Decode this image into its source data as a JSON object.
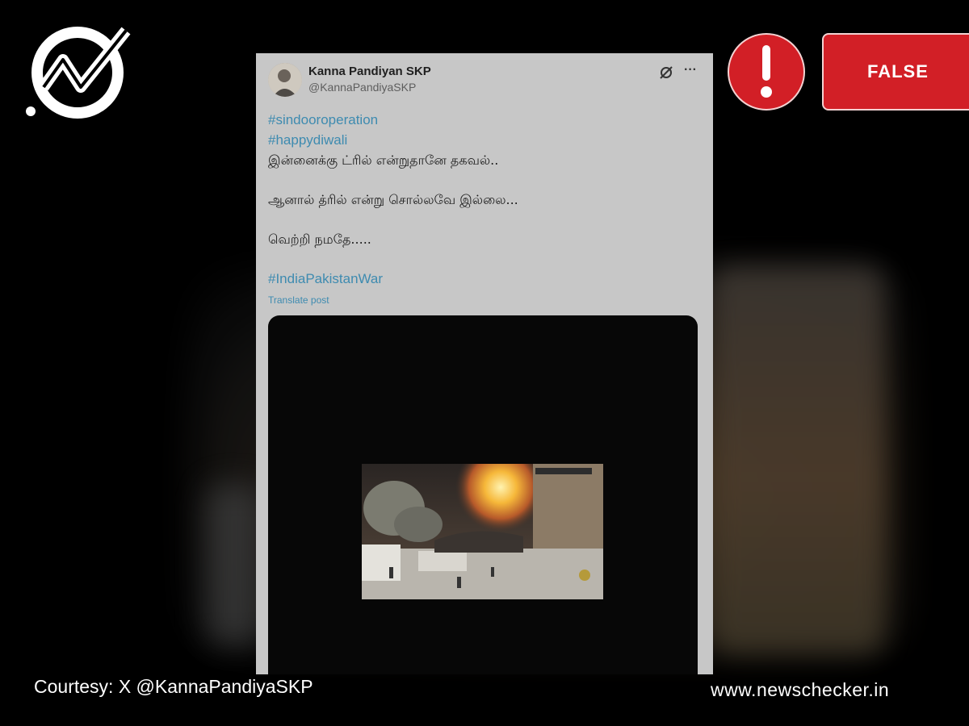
{
  "verdict": {
    "label": "FALSE",
    "color": "#d21f26",
    "icon": "exclamation-icon"
  },
  "logo": {
    "icon": "newschecker-check-logo"
  },
  "tweet": {
    "display_name": "Kanna Pandiyan SKP",
    "handle": "@KannaPandiyaSKP",
    "hashtags_top": [
      "#sindooroperation",
      "#happydiwali"
    ],
    "lines": [
      "இன்னைக்கு ட்ரில் என்றுதானே தகவல்..",
      "ஆனால் த்ரில் என்று சொல்லவே இல்லை...",
      "வெற்றி நமதே....."
    ],
    "hashtag_bottom": "#IndiaPakistanWar",
    "translate_label": "Translate post",
    "media": "video-thumbnail"
  },
  "footer": {
    "courtesy": "Courtesy: X @KannaPandiyaSKP",
    "site": "www.newschecker.in"
  }
}
